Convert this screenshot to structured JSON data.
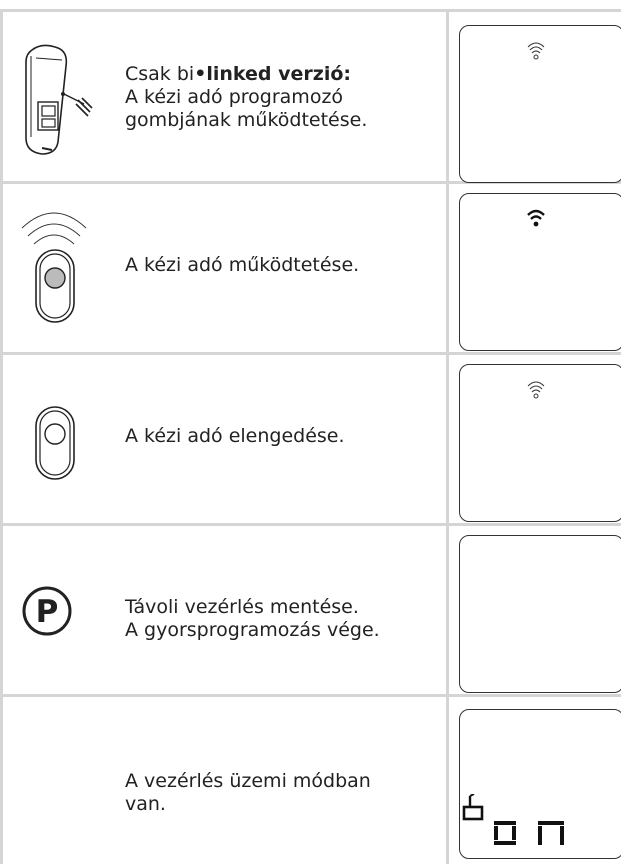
{
  "steps": [
    {
      "icon": "remote-side-wire-icon",
      "text_prefix": "Csak bi",
      "text_bold": "•linked verzió:",
      "text_line2": "A kézi adó programozó",
      "text_line3": "gombjának működtetése.",
      "display_icon": "wifi-outline-icon"
    },
    {
      "icon": "remote-button-pressed-icon",
      "text": "A kézi adó működtetése.",
      "display_icon": "wifi-filled-icon"
    },
    {
      "icon": "remote-button-released-icon",
      "text": "A kézi adó elengedése.",
      "display_icon": "wifi-outline-icon"
    },
    {
      "icon": "p-circle-icon",
      "text_line1": "Távoli vezérlés mentése.",
      "text_line2": "A gyorsprogramozás vége.",
      "display_icon": "none"
    },
    {
      "icon": "none",
      "text_line1": "A vezérlés üzemi módban",
      "text_line2": "van.",
      "display_icon": "operating-mode-icon",
      "display_text": "on"
    }
  ]
}
